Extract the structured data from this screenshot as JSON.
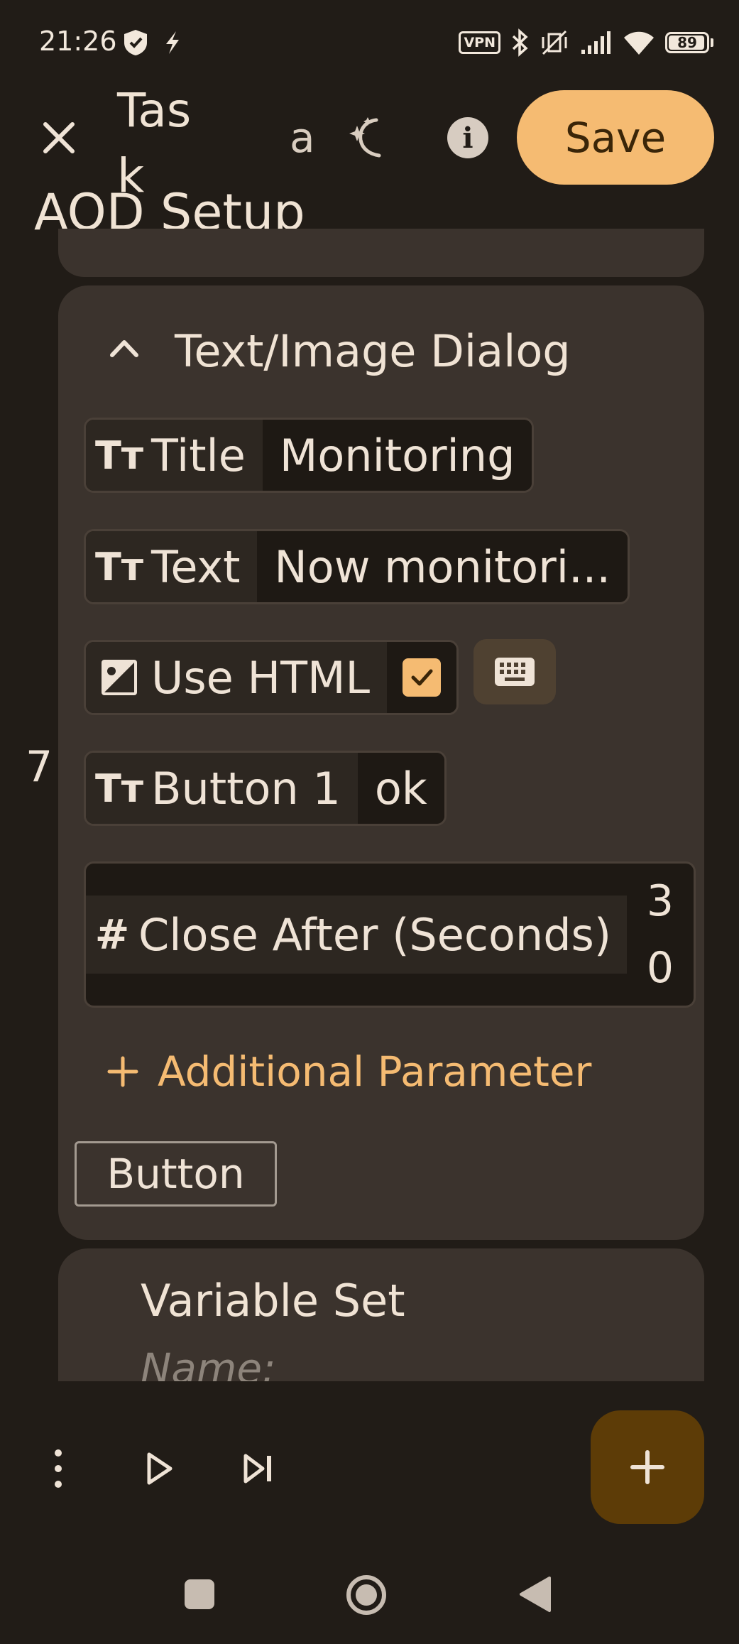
{
  "status_bar": {
    "time": "21:26",
    "vpn_label": "VPN",
    "battery": "89"
  },
  "header": {
    "task_label": "Task",
    "a_glyph": "a",
    "save_label": "Save",
    "info_glyph": "i",
    "profile_title": "AOD Setup"
  },
  "action": {
    "title": "Text/Image Dialog",
    "index": "7",
    "params": {
      "title": {
        "label": "Title",
        "value": "Monitoring"
      },
      "text": {
        "label": "Text",
        "value": "Now monitori..."
      },
      "use_html": {
        "label": "Use HTML",
        "checked": true
      },
      "button1": {
        "label": "Button 1",
        "value": "ok"
      },
      "close_after": {
        "label": "Close After (Seconds)",
        "value_line1": "3",
        "value_line2": "0",
        "value": "30"
      }
    },
    "add_param_label": "Additional Parameter",
    "button_label": "Button"
  },
  "next_action": {
    "title": "Variable Set",
    "name_label": "Name:"
  },
  "icons": [
    "close-icon",
    "magic-moon-icon",
    "info-icon",
    "chevron-up-icon",
    "text-type-icon",
    "image-icon",
    "checkbox-icon",
    "keyboard-icon",
    "hash-icon",
    "plus-icon",
    "more-vert-icon",
    "play-icon",
    "skip-next-icon",
    "add-icon",
    "nav-recents-icon",
    "nav-home-icon",
    "nav-back-icon"
  ],
  "colors": {
    "accent": "#f5bb72",
    "background": "#211c17",
    "card": "#3b332d",
    "fab": "#5d3c07"
  }
}
